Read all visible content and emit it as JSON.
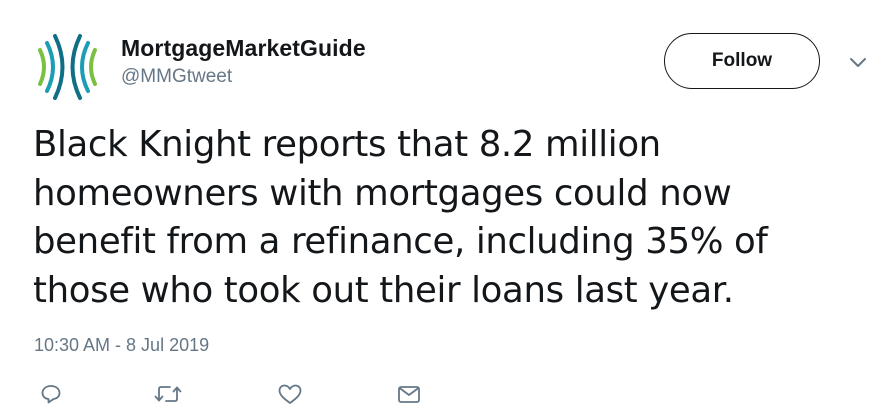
{
  "author": {
    "display_name": "MortgageMarketGuide",
    "handle": "@MMGtweet",
    "avatar_icon": "mmg-logo-icon",
    "logo_colors": [
      "#7ac143",
      "#1a9db5",
      "#0f6f86"
    ]
  },
  "follow": {
    "label": "Follow"
  },
  "menu": {
    "icon": "chevron-down-icon"
  },
  "tweet": {
    "lines": [
      "Black Knight reports that 8.2 million",
      "homeowners with mortgages could now",
      "benefit from a refinance, including 35% of",
      "those who took out their loans last year."
    ],
    "timestamp": "10:30 AM - 8 Jul 2019"
  },
  "actions": [
    {
      "name": "reply",
      "icon": "reply-icon"
    },
    {
      "name": "retweet",
      "icon": "retweet-icon"
    },
    {
      "name": "like",
      "icon": "heart-icon"
    },
    {
      "name": "direct-message",
      "icon": "envelope-icon"
    }
  ],
  "colors": {
    "text_primary": "#14171a",
    "text_secondary": "#657786"
  }
}
